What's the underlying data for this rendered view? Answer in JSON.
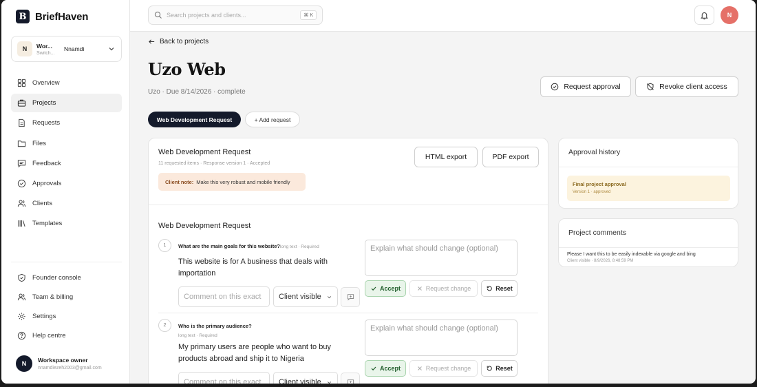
{
  "brand": {
    "logo_letter": "B",
    "name": "BriefHaven"
  },
  "workspace": {
    "avatar": "N",
    "name": "Wor...",
    "sub": "Switch...",
    "user": "Nnamdi"
  },
  "nav": {
    "items": [
      {
        "label": "Overview",
        "icon": "grid-icon"
      },
      {
        "label": "Projects",
        "icon": "briefcase-icon",
        "active": true
      },
      {
        "label": "Requests",
        "icon": "document-icon"
      },
      {
        "label": "Files",
        "icon": "folder-icon"
      },
      {
        "label": "Feedback",
        "icon": "message-icon"
      },
      {
        "label": "Approvals",
        "icon": "check-circle-icon"
      },
      {
        "label": "Clients",
        "icon": "users-icon"
      },
      {
        "label": "Templates",
        "icon": "library-icon"
      }
    ],
    "bottom": [
      {
        "label": "Founder console",
        "icon": "shield-icon"
      },
      {
        "label": "Team & billing",
        "icon": "users-icon"
      },
      {
        "label": "Settings",
        "icon": "gear-icon"
      },
      {
        "label": "Help centre",
        "icon": "help-icon"
      }
    ]
  },
  "owner": {
    "avatar": "N",
    "name": "Workspace owner",
    "email": "nnamdiezeh2003@gmail.com"
  },
  "topbar": {
    "search_placeholder": "Search projects and clients...",
    "shortcut": "⌘ K",
    "avatar": "N"
  },
  "page": {
    "back_label": "Back to projects",
    "title": "Uzo Web",
    "subtitle": "Uzo · Due 8/14/2026 · complete",
    "request_approval": "Request approval",
    "revoke_access": "Revoke client access",
    "tab_active": "Web Development Request",
    "tab_add": "+ Add request"
  },
  "request": {
    "title": "Web Development Request",
    "meta": "11 requested items · Response version 1 · Accepted",
    "note_label": "Client note:",
    "note_text": "Make this very robust and mobile friendly",
    "html_export": "HTML export",
    "pdf_export": "PDF export",
    "section_title": "Web Development Request",
    "questions": [
      {
        "num": "1",
        "text": "What are the main goals for this website?",
        "type": "long text · Required",
        "answer": "This website is for A business that deals with importation",
        "comment_placeholder": "Comment on this exact",
        "visibility": "Client visible",
        "explain_placeholder": "Explain what should change (optional)",
        "accept": "Accept",
        "change": "Request change",
        "reset": "Reset"
      },
      {
        "num": "2",
        "text": "Who is the primary audience?",
        "type": "long text · Required",
        "answer": "My primary users are people who want to buy products abroad and ship it to Nigeria",
        "comment_placeholder": "Comment on this exact",
        "visibility": "Client visible",
        "explain_placeholder": "Explain what should change (optional)",
        "accept": "Accept",
        "change": "Request change",
        "reset": "Reset"
      }
    ]
  },
  "approval_history": {
    "title": "Approval history",
    "item_title": "Final project approval",
    "item_sub": "Version 1 · approved"
  },
  "comments": {
    "title": "Project comments",
    "text": "Please I want this to be easily indexable via google and bing",
    "sub": "Client visible · 8/9/2026, 8:48:59 PM"
  }
}
